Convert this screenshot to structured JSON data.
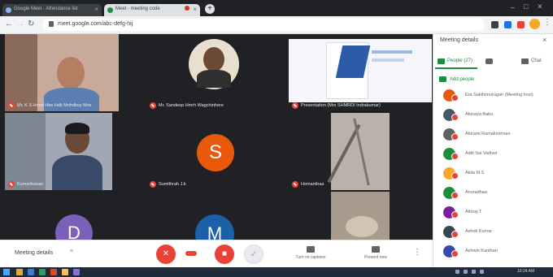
{
  "browser": {
    "tabs": [
      {
        "title": "Google Meet - Attendance list",
        "close": "×"
      },
      {
        "title": "Meet - meeting code",
        "close": "×"
      }
    ],
    "new_tab": "+",
    "url": "meet.google.com/abc-defg-hij",
    "window_controls": {
      "minimize": "–",
      "maximize": "□",
      "close": "×"
    }
  },
  "stage": {
    "tiles": [
      {
        "name": "Mr. K S Hmm Hbe Hdk Mnhdkoy Mnx"
      },
      {
        "name": "Mr. Sandeep Hmrh Wagchinhere"
      },
      {
        "name": "Presentation (Mrs SHMRDI Indrakumar)"
      },
      {
        "name": "Kumarikanan"
      },
      {
        "name": "Sumithrah J.k"
      },
      {
        "name": "Hemanthaa"
      },
      {
        "name": ""
      },
      {
        "name": ""
      },
      {
        "name": ""
      }
    ],
    "avatar_letters": {
      "s": "S",
      "d": "D",
      "m": "M"
    }
  },
  "controls": {
    "meeting_details": "Meeting details",
    "details_caret": "^",
    "captions_label": "Turn on captions",
    "present_label": "Present now",
    "more": "⋮"
  },
  "panel": {
    "title": "Meeting details",
    "close": "×",
    "tabs": {
      "people": "People (27)",
      "chat": "",
      "chat2": "Chat"
    },
    "add_people": "Add people",
    "people": [
      {
        "name": "Era Sakthimurugan (Meeting host)",
        "color": "#e8590c"
      },
      {
        "name": "Abinaya Babu",
        "color": "#455a64"
      },
      {
        "name": "Abirami Ramakrishnan",
        "color": "#616161"
      },
      {
        "name": "Aditi Sai Vadivel",
        "color": "#1e8e3e"
      },
      {
        "name": "Akila M.S",
        "color": "#f9a825"
      },
      {
        "name": "Anuradhaa",
        "color": "#1e8e3e"
      },
      {
        "name": "Athiraj T",
        "color": "#7b1fa2"
      },
      {
        "name": "Ashok Kumar",
        "color": "#37474f"
      },
      {
        "name": "Ashwin Kanthan",
        "color": "#3949ab"
      }
    ]
  },
  "taskbar": {
    "clock": "10:24 AM"
  }
}
